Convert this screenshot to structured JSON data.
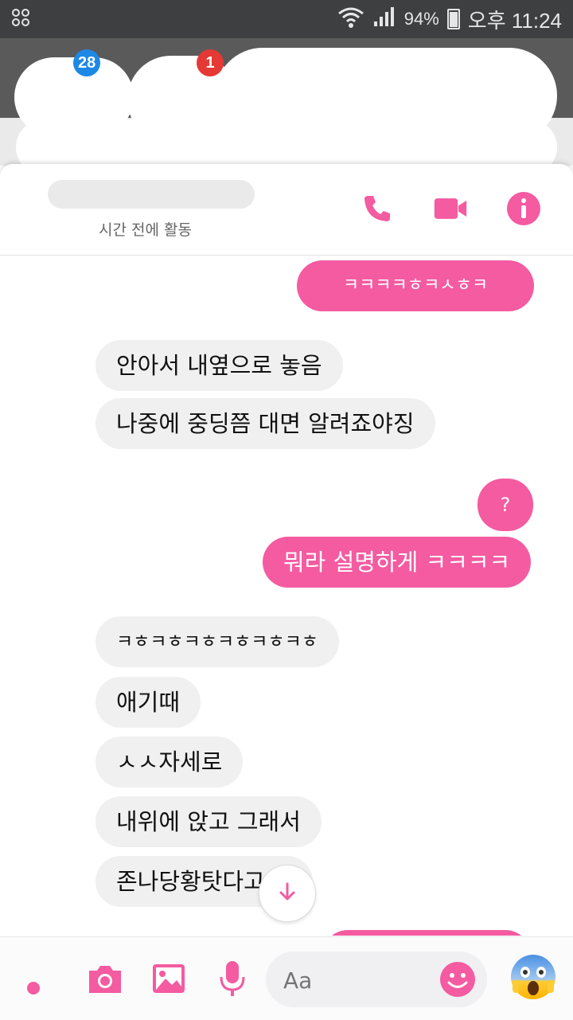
{
  "status_bar": {
    "battery_percent": "94%",
    "time": "오후 11:24"
  },
  "background": {
    "badges": [
      "28",
      "1"
    ]
  },
  "header": {
    "active_status": "시간 전에 활동"
  },
  "messages": [
    {
      "from": "me",
      "text": "ㅋㅋㅋㅋㅎㅋㅅㅎㅋ"
    },
    {
      "from": "them",
      "text": "안아서 내옆으로 놓음"
    },
    {
      "from": "them",
      "text": "나중에 중딩쯤 대면 알려죠야징"
    },
    {
      "from": "me",
      "text": "?"
    },
    {
      "from": "me",
      "text": "뭐라 설명하게 ㅋㅋㅋㅋ"
    },
    {
      "from": "them",
      "text": "ㅋㅎㅋㅎㅋㅎㅋㅎㅋㅎㅋㅎ"
    },
    {
      "from": "them",
      "text": "애기때"
    },
    {
      "from": "them",
      "text": "ㅅㅅ자세로"
    },
    {
      "from": "them",
      "text": "내위에 앉고 그래서"
    },
    {
      "from": "them",
      "text": "존나당황탓다고"
    }
  ],
  "composer": {
    "placeholder": "Aa"
  },
  "colors": {
    "accent": "#f45ba1",
    "bubble_other": "#f0f0f0"
  },
  "icons": [
    "phone-icon",
    "video-call-icon",
    "info-icon",
    "scroll-down-icon",
    "camera-icon",
    "gallery-icon",
    "microphone-icon",
    "smiley-icon",
    "fear-emoji-icon"
  ]
}
